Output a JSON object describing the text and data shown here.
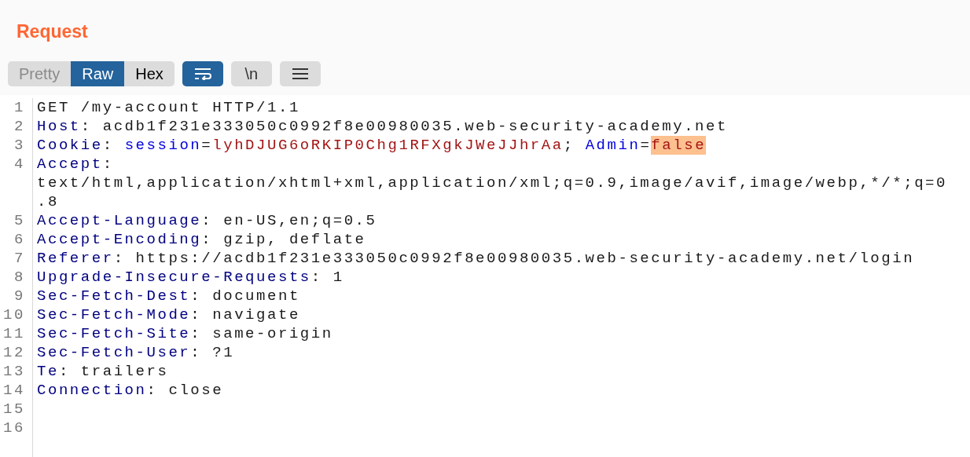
{
  "title": "Request",
  "view_tabs": [
    {
      "label": "Pretty",
      "selected": false
    },
    {
      "label": "Raw",
      "selected": true
    },
    {
      "label": "Hex",
      "selected": false
    }
  ],
  "toggles": [
    {
      "kind": "wrap",
      "on": true
    },
    {
      "kind": "newline",
      "label": "\\n",
      "on": false
    },
    {
      "kind": "menu",
      "on": false
    }
  ],
  "lines": [
    {
      "number": "1",
      "segments": [
        {
          "kind": "plain",
          "text": "GET /my-account HTTP/1.1"
        }
      ]
    },
    {
      "number": "2",
      "segments": [
        {
          "kind": "header",
          "text": "Host"
        },
        {
          "kind": "plain",
          "text": ": acdb1f231e333050c0992f8e00980035.web-security-academy.net"
        }
      ]
    },
    {
      "number": "3",
      "segments": [
        {
          "kind": "header",
          "text": "Cookie"
        },
        {
          "kind": "plain",
          "text": ": "
        },
        {
          "kind": "name",
          "text": "session"
        },
        {
          "kind": "plain",
          "text": "="
        },
        {
          "kind": "value",
          "text": "lyhDJUG6oRKIP0Chg1RFXgkJWeJJhrAa"
        },
        {
          "kind": "plain",
          "text": "; "
        },
        {
          "kind": "name",
          "text": "Admin"
        },
        {
          "kind": "plain",
          "text": "="
        },
        {
          "kind": "value",
          "text": "false",
          "highlighted": true
        }
      ]
    },
    {
      "number": "4",
      "segments": [
        {
          "kind": "header",
          "text": "Accept"
        },
        {
          "kind": "plain",
          "text": ":"
        }
      ],
      "wrapped": [
        "text/html,application/xhtml+xml,application/xml;q=0.9,image/avif,image/webp,*/*;q=0",
        ".8"
      ]
    },
    {
      "number": "5",
      "segments": [
        {
          "kind": "header",
          "text": "Accept-Language"
        },
        {
          "kind": "plain",
          "text": ": en-US,en;q=0.5"
        }
      ]
    },
    {
      "number": "6",
      "segments": [
        {
          "kind": "header",
          "text": "Accept-Encoding"
        },
        {
          "kind": "plain",
          "text": ": gzip, deflate"
        }
      ]
    },
    {
      "number": "7",
      "segments": [
        {
          "kind": "header",
          "text": "Referer"
        },
        {
          "kind": "plain",
          "text": ": https://acdb1f231e333050c0992f8e00980035.web-security-academy.net/login"
        }
      ]
    },
    {
      "number": "8",
      "segments": [
        {
          "kind": "header",
          "text": "Upgrade-Insecure-Requests"
        },
        {
          "kind": "plain",
          "text": ": 1"
        }
      ]
    },
    {
      "number": "9",
      "segments": [
        {
          "kind": "header",
          "text": "Sec-Fetch-Dest"
        },
        {
          "kind": "plain",
          "text": ": document"
        }
      ]
    },
    {
      "number": "10",
      "segments": [
        {
          "kind": "header",
          "text": "Sec-Fetch-Mode"
        },
        {
          "kind": "plain",
          "text": ": navigate"
        }
      ]
    },
    {
      "number": "11",
      "segments": [
        {
          "kind": "header",
          "text": "Sec-Fetch-Site"
        },
        {
          "kind": "plain",
          "text": ": same-origin"
        }
      ]
    },
    {
      "number": "12",
      "segments": [
        {
          "kind": "header",
          "text": "Sec-Fetch-User"
        },
        {
          "kind": "plain",
          "text": ": ?1"
        }
      ]
    },
    {
      "number": "13",
      "segments": [
        {
          "kind": "header",
          "text": "Te"
        },
        {
          "kind": "plain",
          "text": ": trailers"
        }
      ]
    },
    {
      "number": "14",
      "segments": [
        {
          "kind": "header",
          "text": "Connection"
        },
        {
          "kind": "plain",
          "text": ": close"
        }
      ]
    },
    {
      "number": "15"
    },
    {
      "number": "16"
    }
  ]
}
